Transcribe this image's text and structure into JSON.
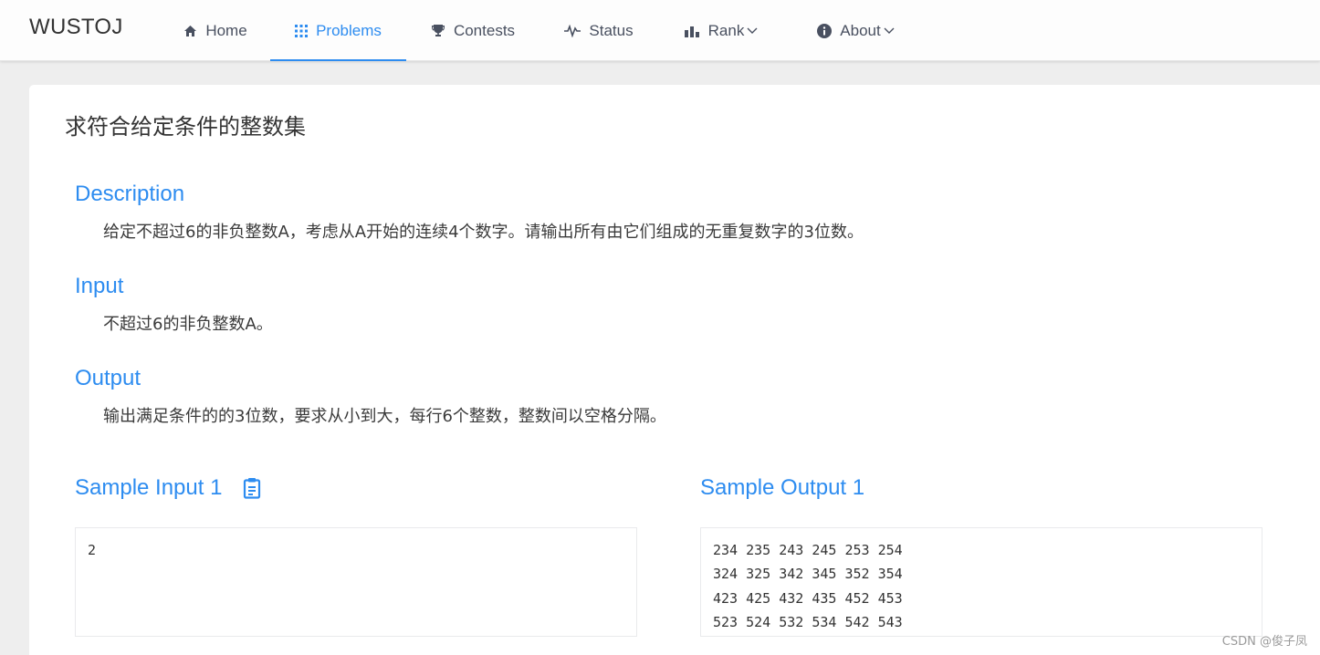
{
  "header": {
    "logo": "WUSTOJ",
    "nav": {
      "home": {
        "label": "Home",
        "icon": "home-icon"
      },
      "problems": {
        "label": "Problems",
        "icon": "grid-icon"
      },
      "contests": {
        "label": "Contests",
        "icon": "trophy-icon"
      },
      "status": {
        "label": "Status",
        "icon": "pulse-icon"
      },
      "rank": {
        "label": "Rank",
        "icon": "bar-chart-icon"
      },
      "about": {
        "label": "About",
        "icon": "info-icon"
      }
    },
    "active_item": "problems",
    "accent_color": "#2d8cf0"
  },
  "problem": {
    "title": "求符合给定条件的整数集",
    "description": {
      "heading": "Description",
      "text": "给定不超过6的非负整数A，考虑从A开始的连续4个数字。请输出所有由它们组成的无重复数字的3位数。"
    },
    "input": {
      "heading": "Input",
      "text": "不超过6的非负整数A。"
    },
    "output": {
      "heading": "Output",
      "text": "输出满足条件的的3位数，要求从小到大，每行6个整数，整数间以空格分隔。"
    },
    "sample_input": {
      "heading": "Sample Input 1",
      "copy_icon": "clipboard-icon",
      "content": "2"
    },
    "sample_output": {
      "heading": "Sample Output 1",
      "content": "234 235 243 245 253 254\n324 325 342 345 352 354\n423 425 432 435 452 453\n523 524 532 534 542 543"
    }
  },
  "watermark": "CSDN @俊子凤"
}
